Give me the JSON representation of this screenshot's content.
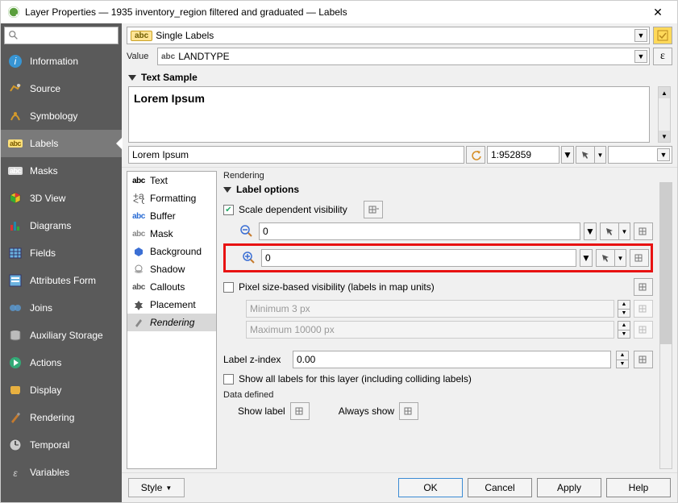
{
  "title": "Layer Properties — 1935 inventory_region filtered and graduated — Labels",
  "search_placeholder": "",
  "sidebar": {
    "items": [
      {
        "label": "Information"
      },
      {
        "label": "Source"
      },
      {
        "label": "Symbology"
      },
      {
        "label": "Labels"
      },
      {
        "label": "Masks"
      },
      {
        "label": "3D View"
      },
      {
        "label": "Diagrams"
      },
      {
        "label": "Fields"
      },
      {
        "label": "Attributes Form"
      },
      {
        "label": "Joins"
      },
      {
        "label": "Auxiliary Storage"
      },
      {
        "label": "Actions"
      },
      {
        "label": "Display"
      },
      {
        "label": "Rendering"
      },
      {
        "label": "Temporal"
      },
      {
        "label": "Variables"
      }
    ]
  },
  "mode": {
    "badge": "abc",
    "label": "Single Labels"
  },
  "value_row": {
    "label": "Value",
    "prefix": "abc",
    "value": "LANDTYPE",
    "epsilon": "ε"
  },
  "text_sample": {
    "heading": "Text Sample",
    "preview": "Lorem Ipsum",
    "edit": "Lorem Ipsum",
    "scale": "1:952859"
  },
  "tabs": [
    {
      "label": "Text"
    },
    {
      "label": "Formatting"
    },
    {
      "label": "Buffer"
    },
    {
      "label": "Mask"
    },
    {
      "label": "Background"
    },
    {
      "label": "Shadow"
    },
    {
      "label": "Callouts"
    },
    {
      "label": "Placement"
    },
    {
      "label": "Rendering"
    }
  ],
  "rendering": {
    "heading": "Rendering",
    "label_options": "Label options",
    "scale_dep": "Scale dependent visibility",
    "min_scale": "0",
    "max_scale": "0",
    "pixel_vis": "Pixel size-based visibility (labels in map units)",
    "min_px": "Minimum 3 px",
    "max_px": "Maximum 10000 px",
    "zindex_label": "Label z-index",
    "zindex_value": "0.00",
    "show_all": "Show all labels for this layer (including colliding labels)",
    "data_defined": "Data defined",
    "show_label": "Show label",
    "always_show": "Always show"
  },
  "footer": {
    "style": "Style",
    "ok": "OK",
    "cancel": "Cancel",
    "apply": "Apply",
    "help": "Help"
  }
}
